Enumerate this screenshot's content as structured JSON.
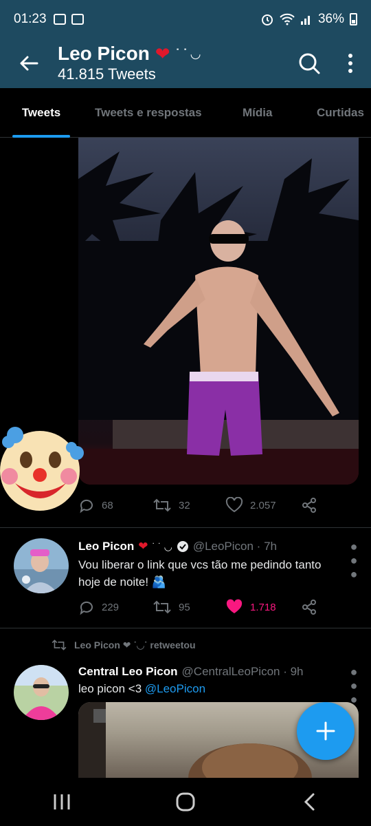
{
  "status_bar": {
    "time": "01:23",
    "battery": "36%"
  },
  "header": {
    "title": "Leo Picon",
    "subtitle": "41.815 Tweets",
    "title_emoji": "❤",
    "title_deco": "˙ ˙ ◡"
  },
  "tabs": [
    {
      "label": "Tweets",
      "active": true
    },
    {
      "label": "Tweets e respostas",
      "active": false
    },
    {
      "label": "Mídia",
      "active": false
    },
    {
      "label": "Curtidas",
      "active": false
    }
  ],
  "tweet1_actions": {
    "replies": "68",
    "retweets": "32",
    "likes": "2.057"
  },
  "tweet2": {
    "name": "Leo Picon",
    "handle": "@LeoPicon · 7h",
    "text": "Vou liberar o link que vcs tão me pedindo tanto hoje de noite! 🫂",
    "replies": "229",
    "retweets": "95",
    "likes": "1.718"
  },
  "retweet_banner": {
    "label": "Leo Picon ❤ ˙◡˙ retweetou"
  },
  "tweet3": {
    "name": "Central Leo Picon",
    "handle": "@CentralLeoPicon · 9h",
    "text_prefix": "leo picon <3 ",
    "text_link": "@LeoPicon"
  },
  "colors": {
    "header_bg": "#1e4a60",
    "accent": "#1d9bf0",
    "like": "#f91880",
    "heart": "#e0182b"
  }
}
